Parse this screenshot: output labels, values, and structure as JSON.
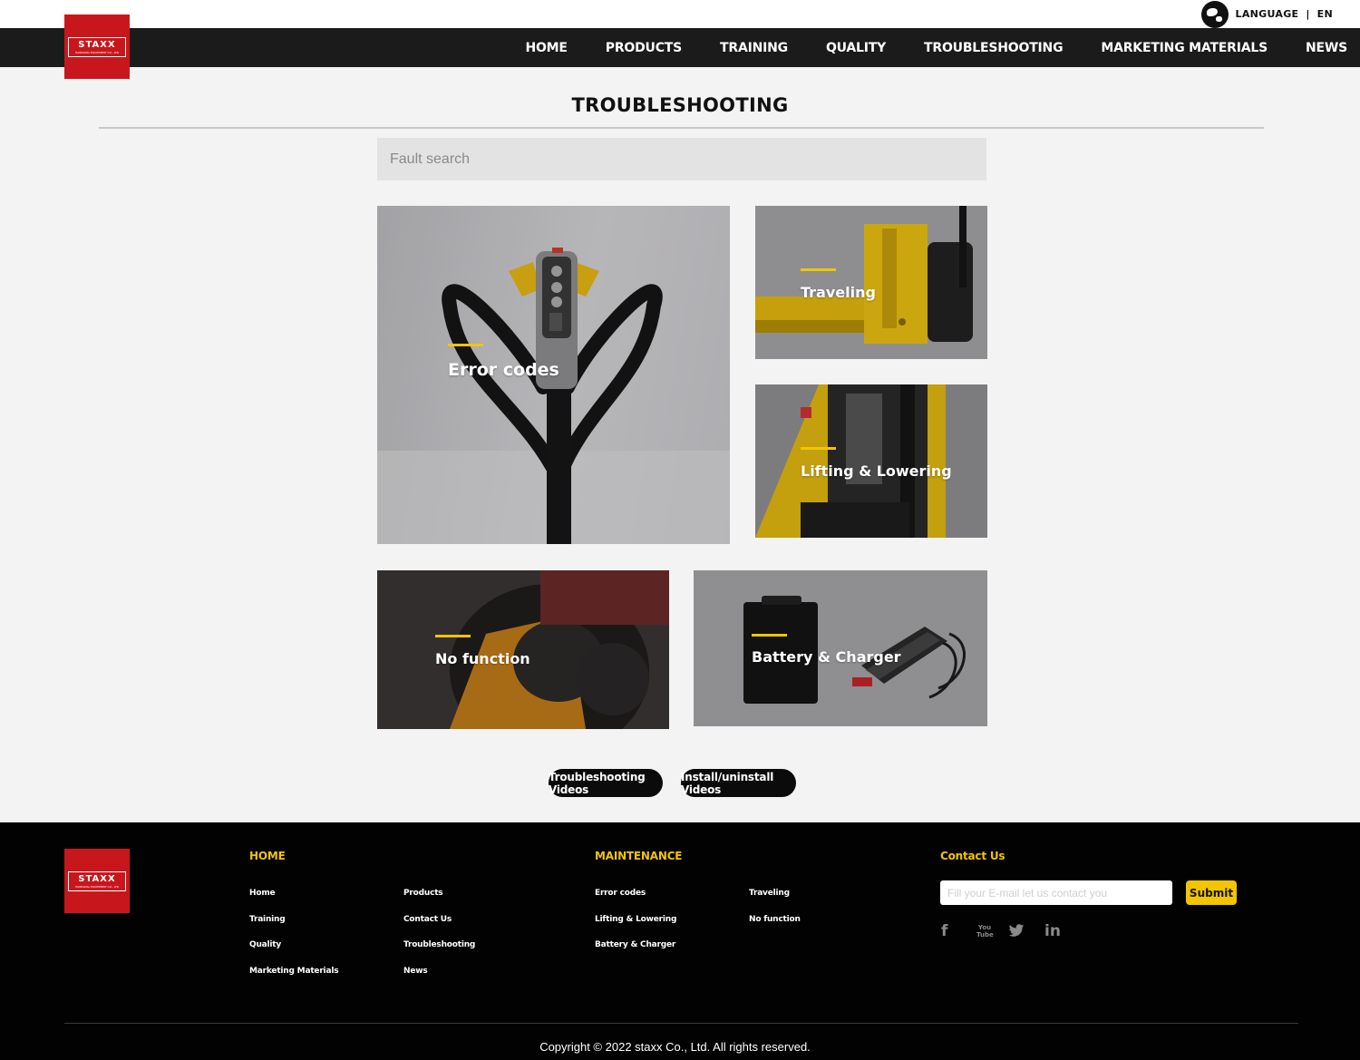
{
  "brand": {
    "logo_text": "STAXX",
    "logo_subtext": "HANDLING EQUIPMENT CO., LTD"
  },
  "language": {
    "label": "LANGUAGE",
    "separator": "|",
    "current": "EN"
  },
  "nav": {
    "items": [
      {
        "label": "HOME"
      },
      {
        "label": "PRODUCTS"
      },
      {
        "label": "TRAINING"
      },
      {
        "label": "QUALITY"
      },
      {
        "label": "TROUBLESHOOTING"
      },
      {
        "label": "MARKETING MATERIALS"
      },
      {
        "label": "NEWS"
      }
    ]
  },
  "page": {
    "title": "TROUBLESHOOTING"
  },
  "search": {
    "placeholder": "Fault search",
    "value": ""
  },
  "categories": {
    "error_codes": "Error codes",
    "traveling": "Traveling",
    "lifting": "Lifting & Lowering",
    "no_function": "No function",
    "battery": "Battery & Charger"
  },
  "buttons": {
    "troubleshooting_videos": "Troubleshooting Videos",
    "install_videos": "Install/uninstall Videos"
  },
  "footer": {
    "home_title": "HOME",
    "home_links": [
      "Home",
      "Products",
      "Training",
      "Contact Us",
      "Quality",
      "Troubleshooting",
      "Marketing Materials",
      "News"
    ],
    "maintenance_title": "MAINTENANCE",
    "maintenance_links": [
      "Error codes",
      "Traveling",
      "Lifting & Lowering",
      "No function",
      "Battery & Charger"
    ],
    "contact_title": "Contact Us",
    "email_placeholder": "Fill your E-mail let us contact you",
    "submit_label": "Submit",
    "social": {
      "facebook": "f",
      "youtube": "You Tube",
      "twitter": "twitter",
      "linkedin": "in"
    },
    "copyright": "Copyright © 2022 staxx Co., Ltd. All rights reserved."
  },
  "colors": {
    "accent": "#f2c500",
    "brand_red": "#c8171c",
    "nav_bg": "#1b1b1b",
    "footer_bg": "#020202"
  }
}
